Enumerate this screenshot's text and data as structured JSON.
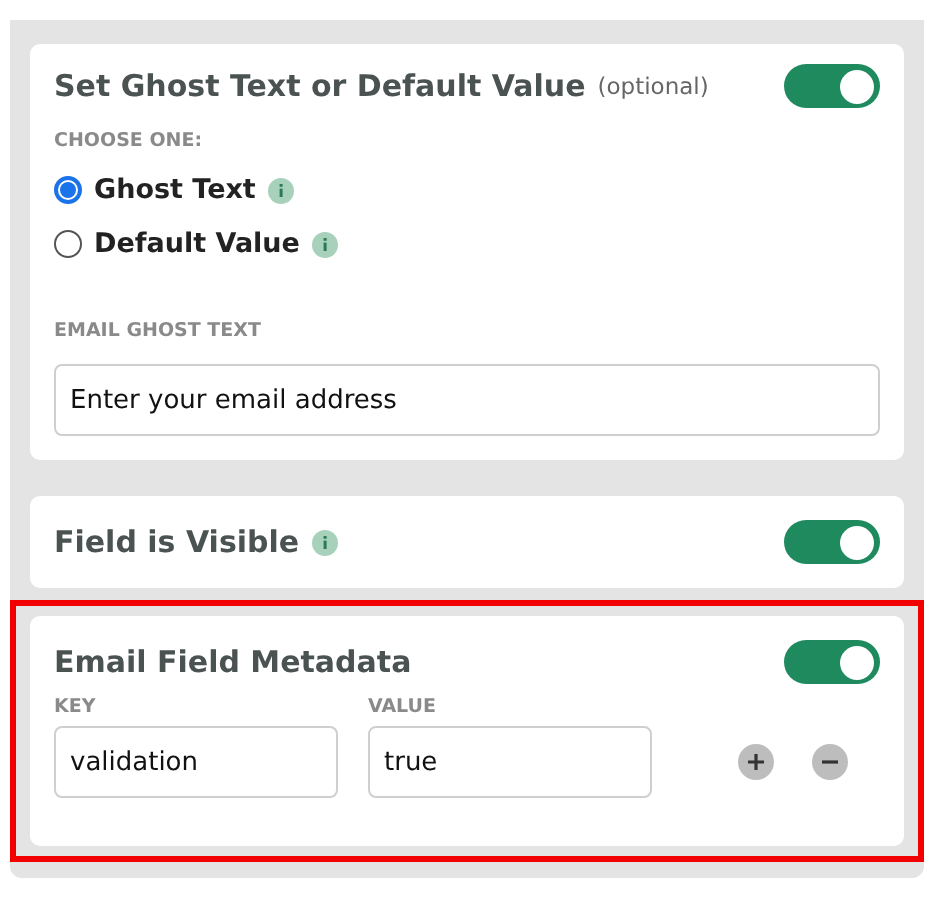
{
  "ghost_section": {
    "title": "Set Ghost Text or Default Value",
    "optional_note": "(optional)",
    "on": true,
    "highlighted": false,
    "choose_label": "CHOOSE ONE:",
    "options": [
      {
        "label": "Ghost Text",
        "selected": true
      },
      {
        "label": "Default Value",
        "selected": false
      }
    ],
    "field_label": "EMAIL GHOST TEXT",
    "field_value": "Enter your email address"
  },
  "visible_section": {
    "title": "Field is Visible",
    "on": true,
    "highlighted": false
  },
  "metadata_section": {
    "title": "Email Field Metadata",
    "on": true,
    "highlighted": true,
    "key_label": "KEY",
    "value_label": "VALUE",
    "rows": [
      {
        "key": "validation",
        "value": "true"
      }
    ]
  }
}
